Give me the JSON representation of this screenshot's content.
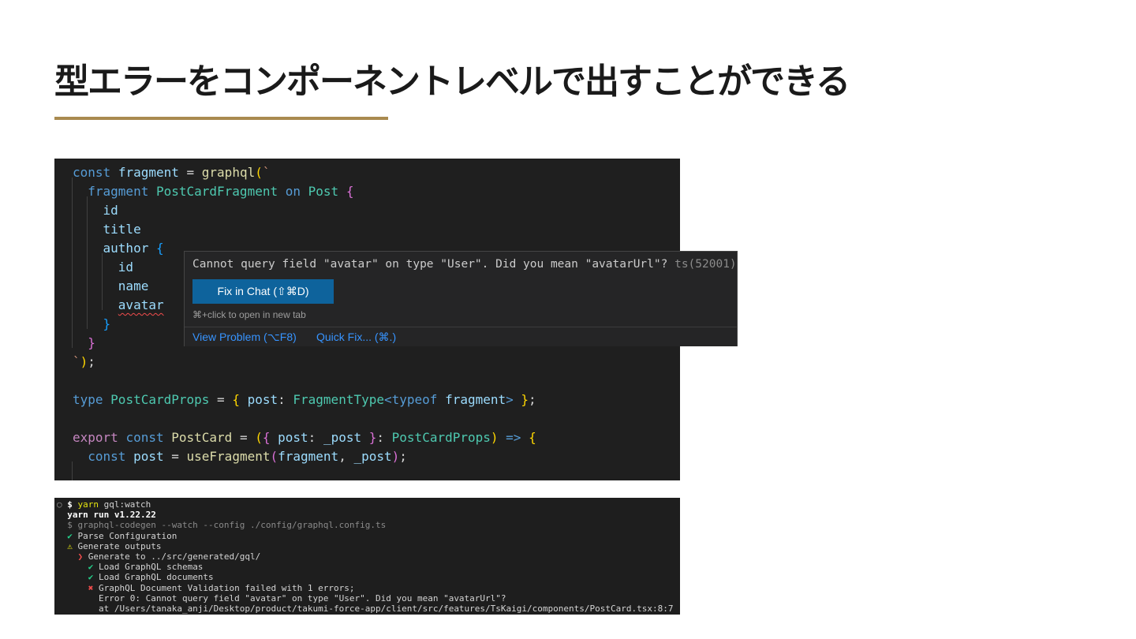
{
  "slide": {
    "title": "型エラーをコンポーネントレベルで出すことができる",
    "accent_color": "#a98a4f"
  },
  "editor": {
    "lines": [
      [
        [
          "k",
          "const"
        ],
        [
          "p",
          " "
        ],
        [
          "v",
          "fragment"
        ],
        [
          "p",
          " = "
        ],
        [
          "f",
          "graphql"
        ],
        [
          "b1",
          "("
        ],
        [
          "s",
          "`"
        ]
      ],
      [
        [
          "p",
          "  "
        ],
        [
          "k",
          "fragment"
        ],
        [
          "p",
          " "
        ],
        [
          "t",
          "PostCardFragment"
        ],
        [
          "p",
          " "
        ],
        [
          "k",
          "on"
        ],
        [
          "p",
          " "
        ],
        [
          "t",
          "Post"
        ],
        [
          "p",
          " "
        ],
        [
          "b2",
          "{"
        ]
      ],
      [
        [
          "p",
          "    "
        ],
        [
          "v",
          "id"
        ]
      ],
      [
        [
          "p",
          "    "
        ],
        [
          "v",
          "title"
        ]
      ],
      [
        [
          "p",
          "    "
        ],
        [
          "v",
          "author"
        ],
        [
          "p",
          " "
        ],
        [
          "b3",
          "{"
        ]
      ],
      [
        [
          "p",
          "      "
        ],
        [
          "v",
          "id"
        ]
      ],
      [
        [
          "p",
          "      "
        ],
        [
          "v",
          "name"
        ]
      ],
      [
        [
          "p",
          "      "
        ],
        [
          "v squiggle",
          "avatar"
        ]
      ],
      [
        [
          "p",
          "    "
        ],
        [
          "b3",
          "}"
        ]
      ],
      [
        [
          "p",
          "  "
        ],
        [
          "b2",
          "}"
        ]
      ],
      [
        [
          "s",
          "`"
        ],
        [
          "b1",
          ")"
        ],
        [
          "p",
          ";"
        ]
      ],
      [],
      [
        [
          "k",
          "type"
        ],
        [
          "p",
          " "
        ],
        [
          "t",
          "PostCardProps"
        ],
        [
          "p",
          " = "
        ],
        [
          "b1",
          "{"
        ],
        [
          "p",
          " "
        ],
        [
          "v",
          "post"
        ],
        [
          "p",
          ": "
        ],
        [
          "t",
          "FragmentType"
        ],
        [
          "k",
          "<"
        ],
        [
          "k",
          "typeof"
        ],
        [
          "p",
          " "
        ],
        [
          "v",
          "fragment"
        ],
        [
          "k",
          ">"
        ],
        [
          "p",
          " "
        ],
        [
          "b1",
          "}"
        ],
        [
          "p",
          ";"
        ]
      ],
      [],
      [
        [
          "kp",
          "export"
        ],
        [
          "p",
          " "
        ],
        [
          "k",
          "const"
        ],
        [
          "p",
          " "
        ],
        [
          "f",
          "PostCard"
        ],
        [
          "p",
          " = "
        ],
        [
          "b1",
          "("
        ],
        [
          "b2",
          "{"
        ],
        [
          "p",
          " "
        ],
        [
          "v",
          "post"
        ],
        [
          "p",
          ": "
        ],
        [
          "v",
          "_post"
        ],
        [
          "p",
          " "
        ],
        [
          "b2",
          "}"
        ],
        [
          "p",
          ": "
        ],
        [
          "t",
          "PostCardProps"
        ],
        [
          "b1",
          ")"
        ],
        [
          "p",
          " "
        ],
        [
          "k",
          "=>"
        ],
        [
          "p",
          " "
        ],
        [
          "b1",
          "{"
        ]
      ],
      [
        [
          "p",
          "  "
        ],
        [
          "k",
          "const"
        ],
        [
          "p",
          " "
        ],
        [
          "v",
          "post"
        ],
        [
          "p",
          " = "
        ],
        [
          "f",
          "useFragment"
        ],
        [
          "b2",
          "("
        ],
        [
          "v",
          "fragment"
        ],
        [
          "p",
          ", "
        ],
        [
          "v",
          "_post"
        ],
        [
          "b2",
          ")"
        ],
        [
          "p",
          ";"
        ]
      ]
    ]
  },
  "hover": {
    "message": "Cannot query field \"avatar\" on type \"User\". Did you mean \"avatarUrl\"?",
    "code": "ts(52001)",
    "fix_button": "Fix in Chat (⇧⌘D)",
    "hint": "⌘+click to open in new tab",
    "view_problem": "View Problem (⌥F8)",
    "quick_fix": "Quick Fix... (⌘.)"
  },
  "terminal": {
    "lines": [
      [
        [
          "circle",
          "○ "
        ],
        [
          "bold",
          "$ "
        ],
        [
          "yel",
          "yarn"
        ],
        [
          "p",
          " gql:watch"
        ]
      ],
      [
        [
          "bold",
          "  yarn run v1.22.22"
        ]
      ],
      [
        [
          "dim",
          "  $ graphql-codegen --watch --config ./config/graphql.config.ts"
        ]
      ],
      [
        [
          "grn",
          "  ✔"
        ],
        [
          "p",
          " Parse Configuration"
        ]
      ],
      [
        [
          "yel",
          "  ⚠"
        ],
        [
          "p",
          " Generate outputs"
        ]
      ],
      [
        [
          "red",
          "    ❯"
        ],
        [
          "p",
          " Generate to ../src/generated/gql/"
        ]
      ],
      [
        [
          "grn",
          "      ✔"
        ],
        [
          "p",
          " Load GraphQL schemas"
        ]
      ],
      [
        [
          "grn",
          "      ✔"
        ],
        [
          "p",
          " Load GraphQL documents"
        ]
      ],
      [
        [
          "red",
          "      ✖"
        ],
        [
          "p",
          " GraphQL Document Validation failed with 1 errors;"
        ]
      ],
      [
        [
          "p",
          "        Error 0: Cannot query field \"avatar\" on type \"User\". Did you mean \"avatarUrl\"?"
        ]
      ],
      [
        [
          "p",
          "        at /Users/tanaka_anji/Desktop/product/takumi-force-app/client/src/features/TsKaigi/components/PostCard.tsx:8:7"
        ]
      ]
    ]
  }
}
